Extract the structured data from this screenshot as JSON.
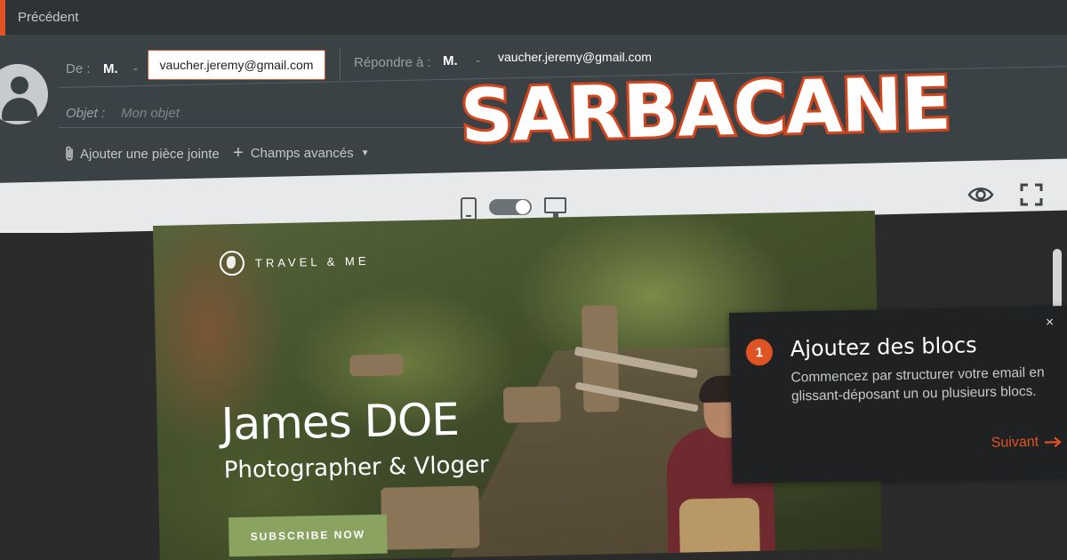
{
  "topbar": {
    "prev_label": "Précédent"
  },
  "header": {
    "from_label": "De :",
    "from_name": "M.",
    "from_email": "vaucher.jeremy@gmail.com",
    "reply_label": "Répondre à :",
    "reply_name": "M.",
    "reply_email": "vaucher.jeremy@gmail.com",
    "subject_label": "Objet :",
    "subject_placeholder": "Mon objet",
    "attach_label": "Ajouter une pièce jointe",
    "advanced_label": "Champs avancés"
  },
  "logo_text": "SARBACANE",
  "toolbar": {
    "icons": [
      "mobile-view-icon",
      "view-toggle",
      "desktop-view-icon",
      "preview-eye-icon",
      "fullscreen-icon"
    ]
  },
  "email": {
    "brand": "TRAVEL & ME",
    "name": "James DOE",
    "subtitle": "Photographer & Vloger",
    "cta": "SUBSCRIBE NOW"
  },
  "tooltip": {
    "step": "1",
    "title": "Ajoutez des blocs",
    "body": "Commencez par structurer votre email en glissant-déposant un ou plusieurs blocs.",
    "next_label": "Suivant",
    "close_glyph": "×"
  },
  "colors": {
    "accent": "#e05424",
    "header_bg": "#3b4246",
    "toolbar_bg": "#e8e9ea",
    "cta_green": "#8aa360"
  }
}
